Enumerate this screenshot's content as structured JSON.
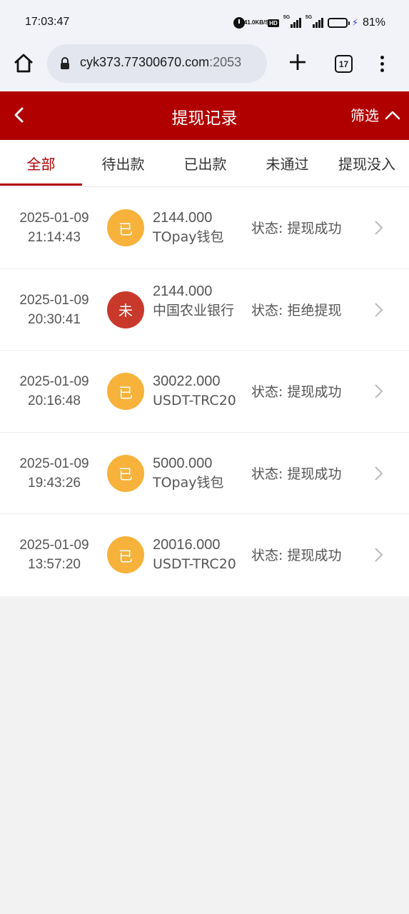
{
  "status_bar": {
    "time": "17:03:47",
    "net_speed_value": "41.0",
    "net_speed_unit": "KB/S",
    "hd_label": "HD",
    "sig1_label": "5G",
    "sig2_label": "5G",
    "battery_percent": "81%",
    "battery_level": 0.81
  },
  "browser": {
    "url_main": "cyk373.77300670.com",
    "url_port": ":2053",
    "tab_count": "17"
  },
  "header": {
    "title": "提现记录",
    "filter_label": "筛选"
  },
  "tabs": [
    {
      "label": "全部",
      "active": true
    },
    {
      "label": "待出款",
      "active": false
    },
    {
      "label": "已出款",
      "active": false
    },
    {
      "label": "未通过",
      "active": false
    },
    {
      "label": "提现没入",
      "active": false
    }
  ],
  "records": [
    {
      "date": "2025-01-09",
      "time": "21:14:43",
      "badge": "已",
      "badge_color": "#f7b23b",
      "amount": "2144.000",
      "method": "TOpay钱包",
      "status_label": "状态:",
      "status_value": "提现成功"
    },
    {
      "date": "2025-01-09",
      "time": "20:30:41",
      "badge": "未",
      "badge_color": "#c8392b",
      "amount": "2144.000",
      "method": "中国农业银行",
      "status_label": "状态:",
      "status_value": "拒绝提现"
    },
    {
      "date": "2025-01-09",
      "time": "20:16:48",
      "badge": "已",
      "badge_color": "#f7b23b",
      "amount": "30022.000",
      "method": "USDT-TRC20",
      "status_label": "状态:",
      "status_value": "提现成功"
    },
    {
      "date": "2025-01-09",
      "time": "19:43:26",
      "badge": "已",
      "badge_color": "#f7b23b",
      "amount": "5000.000",
      "method": "TOpay钱包",
      "status_label": "状态:",
      "status_value": "提现成功"
    },
    {
      "date": "2025-01-09",
      "time": "13:57:20",
      "badge": "已",
      "badge_color": "#f7b23b",
      "amount": "20016.000",
      "method": "USDT-TRC20",
      "status_label": "状态:",
      "status_value": "提现成功"
    }
  ],
  "colors": {
    "brand_red": "#b10000",
    "success_badge": "#f7b23b",
    "rejected_badge": "#c8392b"
  }
}
